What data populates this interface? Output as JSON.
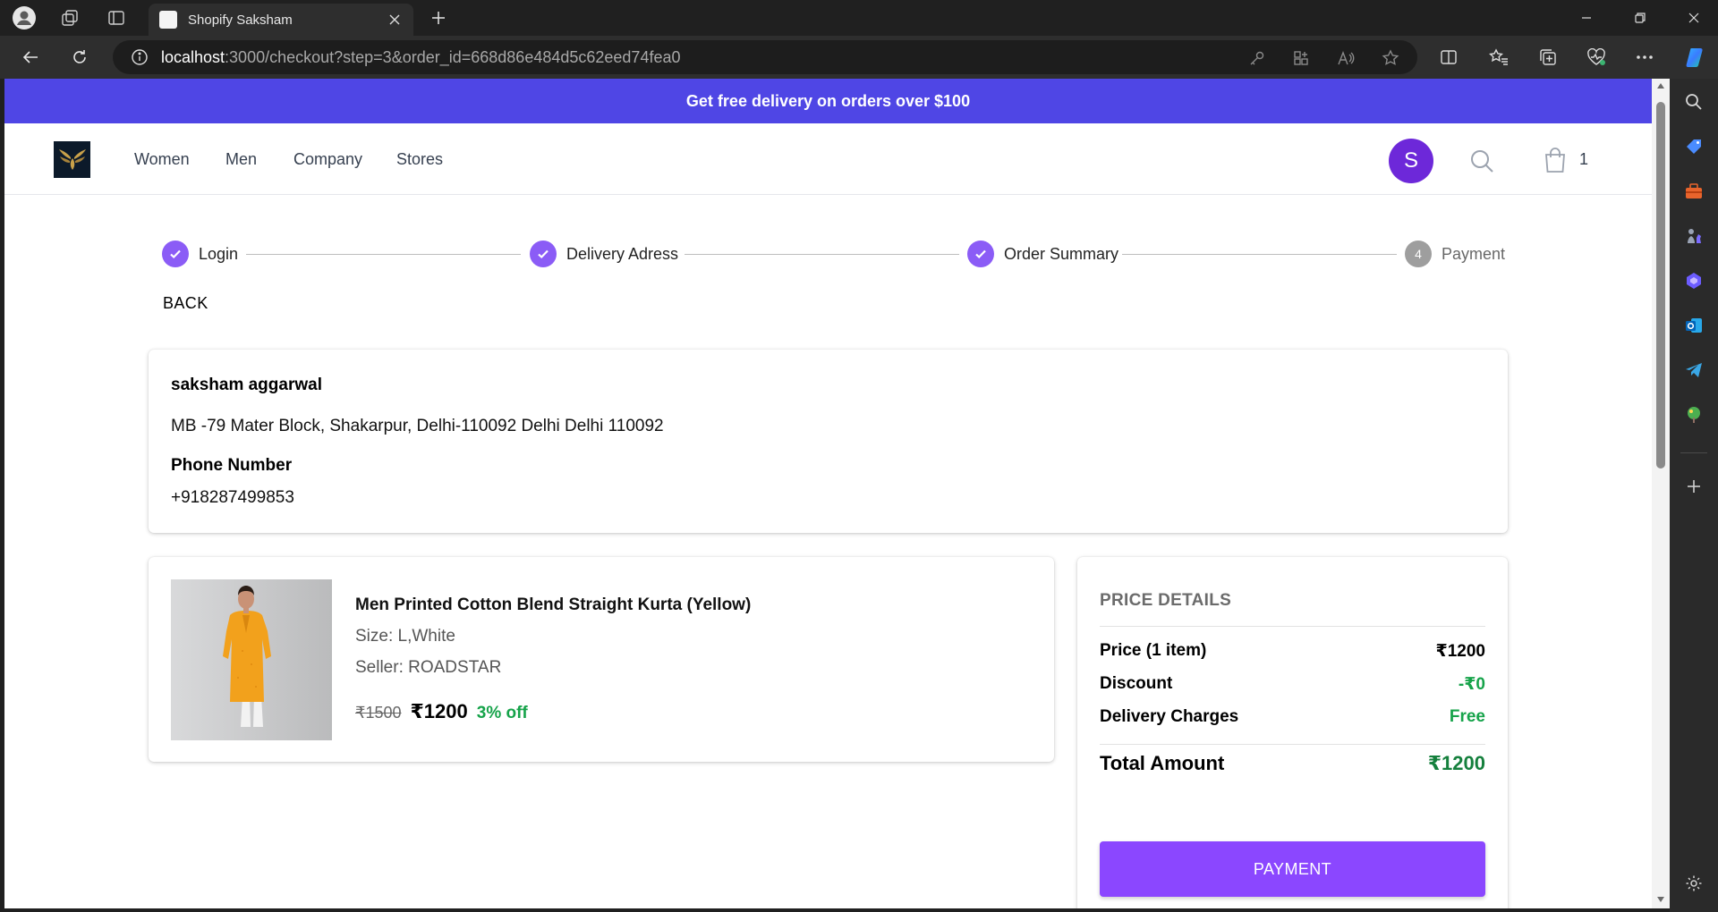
{
  "browser": {
    "tab_title": "Shopify Saksham",
    "url_host": "localhost",
    "url_rest": ":3000/checkout?step=3&order_id=668d86e484d5c62eed74fea0"
  },
  "promo": {
    "text": "Get free delivery on orders over $100"
  },
  "header": {
    "nav": [
      "Women",
      "Men",
      "Company",
      "Stores"
    ],
    "avatar_letter": "S",
    "cart_count": "1"
  },
  "stepper": {
    "steps": [
      {
        "label": "Login",
        "status": "done"
      },
      {
        "label": "Delivery Adress",
        "status": "done"
      },
      {
        "label": "Order Summary",
        "status": "done"
      },
      {
        "label": "Payment",
        "status": "pending",
        "number": "4"
      }
    ],
    "back_label": "BACK"
  },
  "address": {
    "name": "saksham aggarwal",
    "line": "MB -79 Mater Block, Shakarpur, Delhi-110092 Delhi Delhi 110092",
    "phone_label": "Phone Number",
    "phone": "+918287499853"
  },
  "product": {
    "title": "Men Printed Cotton Blend Straight Kurta (Yellow)",
    "size": "Size: L,White",
    "seller": "Seller: ROADSTAR",
    "price_old": "₹1500",
    "price_new": "₹1200",
    "discount": "3% off"
  },
  "price_details": {
    "title": "PRICE DETAILS",
    "price_label": "Price (1 item)",
    "price_value": "₹1200",
    "discount_label": "Discount",
    "discount_value": "-₹0",
    "delivery_label": "Delivery Charges",
    "delivery_value": "Free",
    "total_label": "Total Amount",
    "total_value": "₹1200",
    "button": "PAYMENT"
  },
  "colors": {
    "promo": "#4f46e5",
    "accent": "#8b5cf6",
    "payment_button": "#8b47ff",
    "green": "#16a34a"
  }
}
